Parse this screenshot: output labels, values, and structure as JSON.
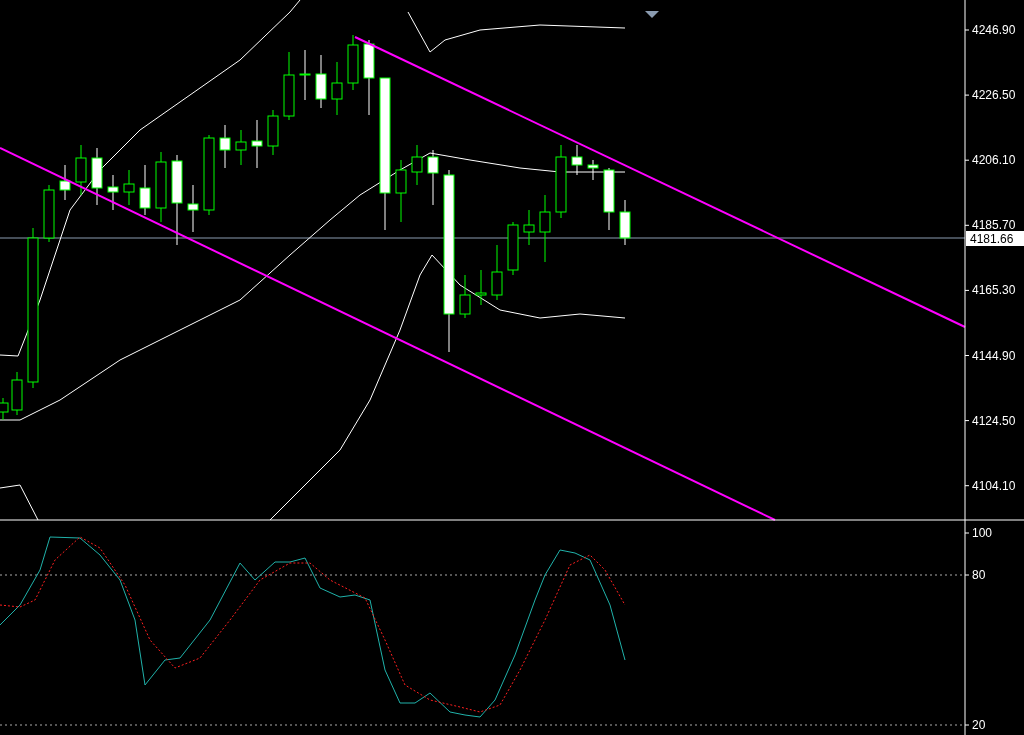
{
  "price_axis": {
    "labels": [
      "4246.90",
      "4226.50",
      "4206.10",
      "4185.70",
      "4165.30",
      "4144.90",
      "4124.50",
      "4104.10"
    ],
    "current_price": "4181.66"
  },
  "indicator_axis": {
    "labels": [
      "100",
      "80",
      "20"
    ]
  }
}
